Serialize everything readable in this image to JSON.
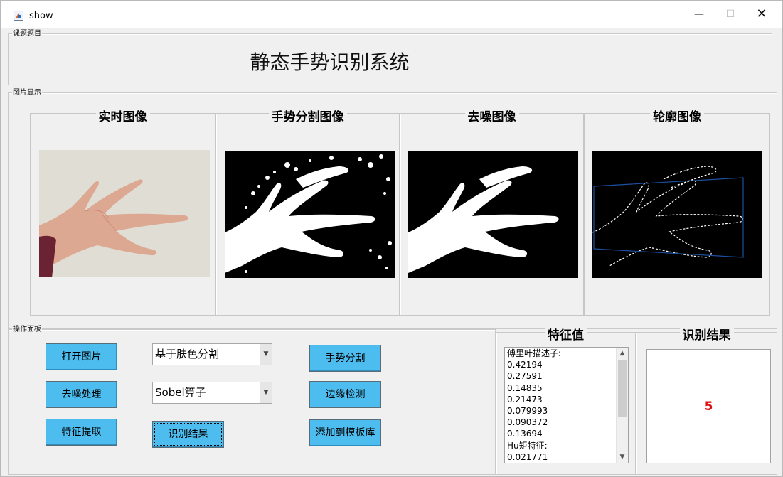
{
  "window": {
    "title": "show",
    "minimize": "—",
    "maximize": "☐",
    "close": "✕"
  },
  "topic_panel": {
    "legend": "课题题目",
    "title": "静态手势识别系统"
  },
  "image_panel": {
    "legend": "图片显示",
    "frames": [
      {
        "title": "实时图像"
      },
      {
        "title": "手势分割图像"
      },
      {
        "title": "去噪图像"
      },
      {
        "title": "轮廓图像"
      }
    ]
  },
  "operation_panel": {
    "legend": "操作面板",
    "buttons": {
      "open_image": "打开图片",
      "denoise": "去噪处理",
      "feature_extract": "特征提取",
      "gesture_segment": "手势分割",
      "edge_detect": "边缘检测",
      "recognize_result": "识别结果",
      "add_to_template": "添加到模板库"
    },
    "selects": {
      "segment_method": "基于肤色分割",
      "edge_operator": "Sobel算子"
    }
  },
  "feature_panel": {
    "title": "特征值",
    "lines": [
      "傅里叶描述子:",
      "0.42194",
      "0.27591",
      "0.14835",
      "0.21473",
      "0.079993",
      "0.090372",
      "0.13694",
      "Hu矩特征:",
      "0.021771"
    ]
  },
  "result_panel": {
    "title": "识别结果",
    "value": "5"
  },
  "colors": {
    "button_bg": "#4dbdf0",
    "result_text": "#e01010",
    "contour_line": "#1d4f9e"
  },
  "icons": {
    "up": "▲",
    "down": "▼",
    "dropdown": "▼"
  }
}
